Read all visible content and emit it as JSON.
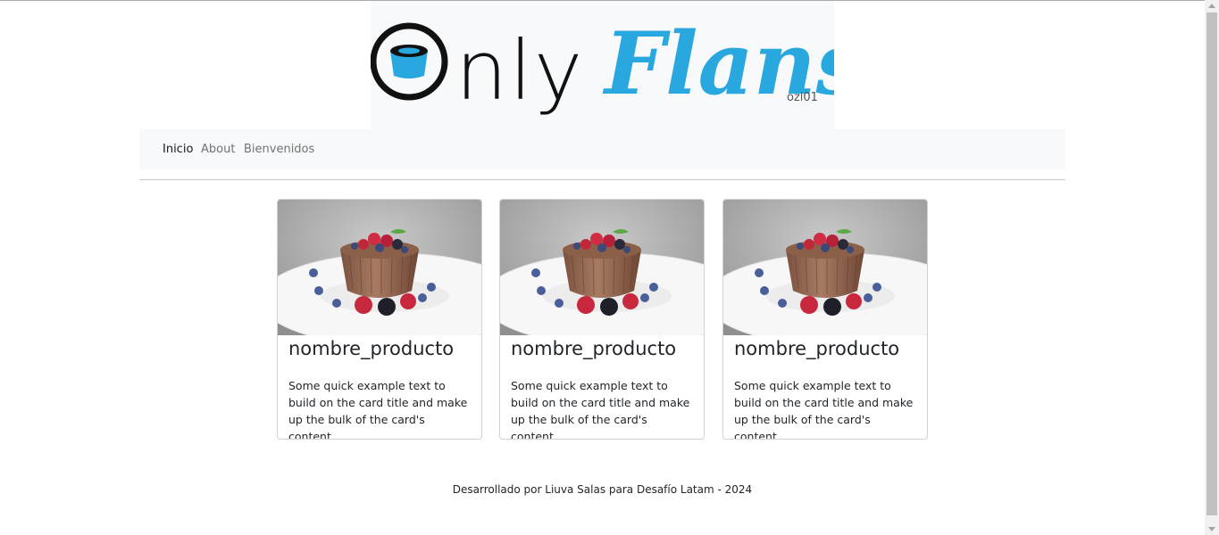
{
  "logo": {
    "text_primary": "Only",
    "text_secondary": "Flans",
    "badge": "ozl01",
    "colors": {
      "dark": "#111111",
      "accent": "#29a8e0"
    }
  },
  "nav": {
    "items": [
      {
        "label": "Inicio",
        "active": true
      },
      {
        "label": "About",
        "active": false
      },
      {
        "label": "Bienvenidos",
        "active": false
      }
    ]
  },
  "cards": [
    {
      "image": "chocolate-flan-with-berries",
      "title": "nombre_producto",
      "text": "Some quick example text to build on the card title and make up the bulk of the card's content."
    },
    {
      "image": "chocolate-flan-with-berries",
      "title": "nombre_producto",
      "text": "Some quick example text to build on the card title and make up the bulk of the card's content."
    },
    {
      "image": "chocolate-flan-with-berries",
      "title": "nombre_producto",
      "text": "Some quick example text to build on the card title and make up the bulk of the card's content."
    }
  ],
  "footer": {
    "text": "Desarrollado por Liuva Salas para Desafío Latam - 2024"
  }
}
